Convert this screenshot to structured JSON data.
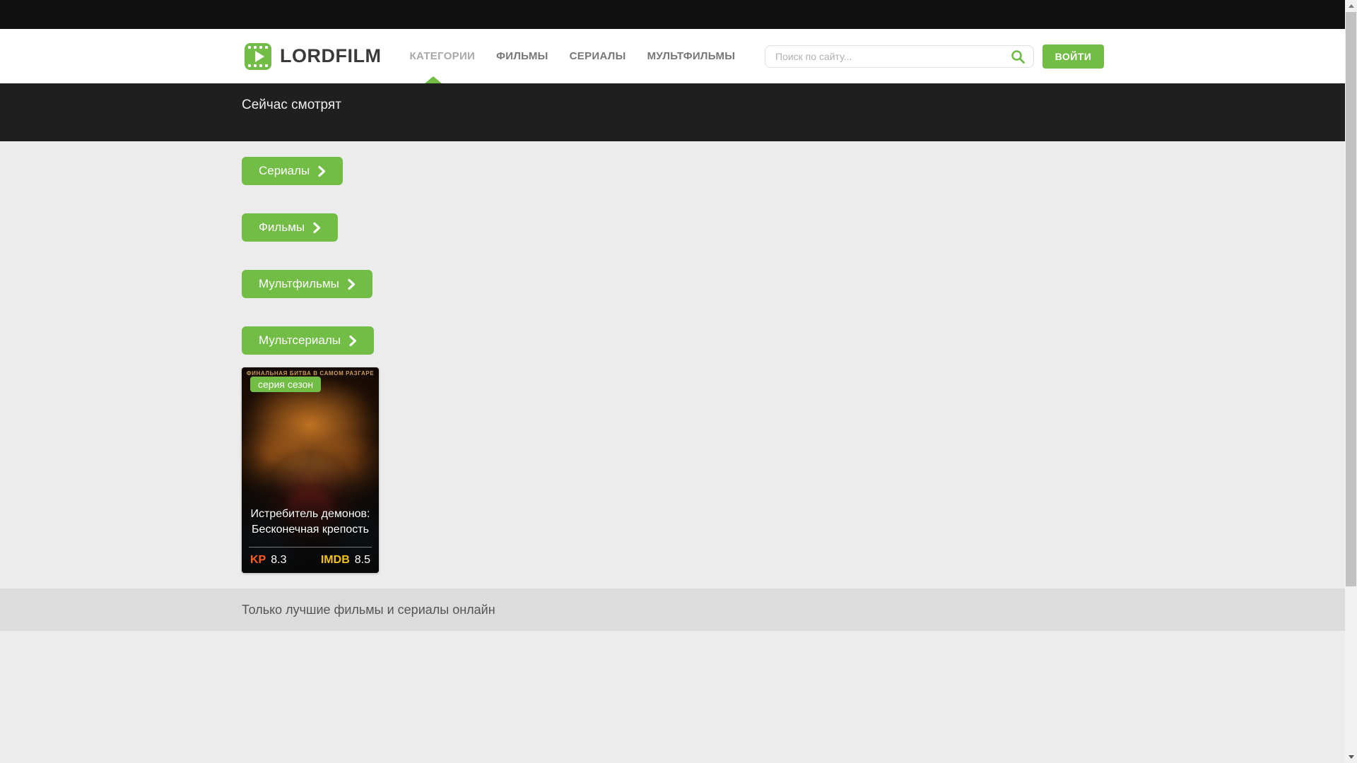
{
  "page": {
    "accent_color": "#71bd46",
    "outer_bg": "#101010",
    "content_bg": "#ececec"
  },
  "header": {
    "logo_text": "LORDFILM",
    "nav": [
      {
        "label": "КАТЕГОРИИ",
        "active": true
      },
      {
        "label": "ФИЛЬМЫ",
        "active": false
      },
      {
        "label": "СЕРИАЛЫ",
        "active": false
      },
      {
        "label": "МУЛЬТФИЛЬМЫ",
        "active": false
      }
    ],
    "search": {
      "placeholder": "Поиск по сайту...",
      "value": ""
    },
    "login_label": "ВОЙТИ"
  },
  "hero": {
    "title": "Сейчас смотрят"
  },
  "categories": [
    {
      "label": "Сериалы"
    },
    {
      "label": "Фильмы"
    },
    {
      "label": "Мультфильмы"
    },
    {
      "label": "Мультсериалы"
    }
  ],
  "movie_card": {
    "badge": "серия сезон",
    "poster_tagline": "ФИНАЛЬНАЯ БИТВА В САМОМ РАЗГАРЕ",
    "title_line1": "Истребитель демонов:",
    "title_line2": "Бесконечная крепость",
    "ratings": {
      "kp_label": "KP",
      "kp_value": "8.3",
      "imdb_label": "IMDB",
      "imdb_value": "8.5",
      "kp_color": "#ff5d1f",
      "imdb_color": "#f2c118"
    }
  },
  "footer": {
    "tagline": "Только лучшие фильмы и сериалы онлайн"
  }
}
